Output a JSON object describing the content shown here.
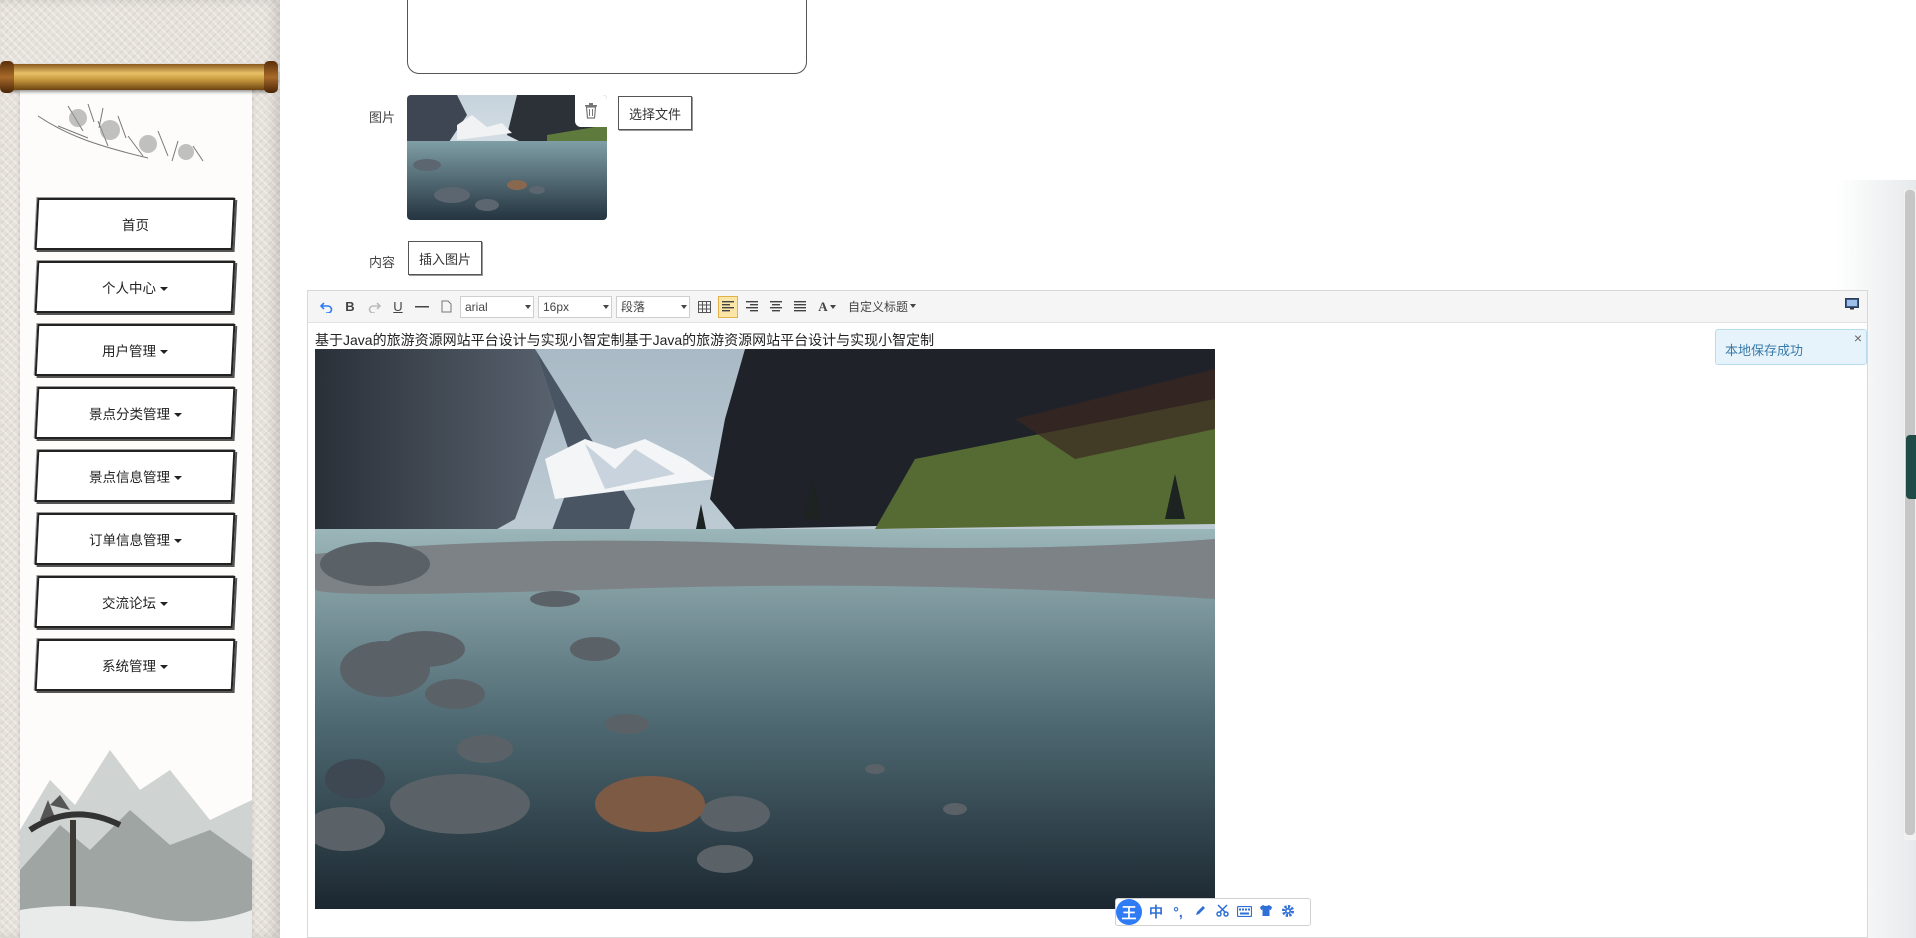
{
  "sidebar": {
    "items": [
      {
        "label": "首页",
        "has_caret": false
      },
      {
        "label": "个人中心",
        "has_caret": true
      },
      {
        "label": "用户管理",
        "has_caret": true
      },
      {
        "label": "景点分类管理",
        "has_caret": true
      },
      {
        "label": "景点信息管理",
        "has_caret": true
      },
      {
        "label": "订单信息管理",
        "has_caret": true
      },
      {
        "label": "交流论坛",
        "has_caret": true
      },
      {
        "label": "系统管理",
        "has_caret": true
      }
    ]
  },
  "form": {
    "image_label": "图片",
    "choose_file_label": "选择文件",
    "content_label": "内容",
    "insert_image_label": "插入图片"
  },
  "editor": {
    "toolbar": {
      "font_family": "arial",
      "font_size": "16px",
      "paragraph": "段落",
      "custom_title": "自定义标题"
    },
    "content_text": "基于Java的旅游资源网站平台设计与实现小智定制基于Java的旅游资源网站平台设计与实现小智定制",
    "toast": "本地保存成功",
    "toast_close": "×"
  },
  "ime": {
    "logo": "王",
    "mode": "中",
    "punct": "°,"
  },
  "colors": {
    "accent_blue": "#2f7bf5",
    "toast_bg": "#e6f3fb"
  }
}
